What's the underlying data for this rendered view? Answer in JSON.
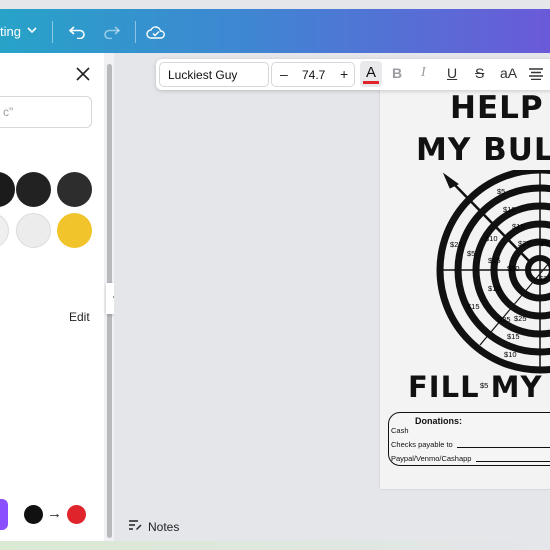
{
  "topbar": {
    "mode_label": "ting",
    "icons": [
      "chevron-down-icon",
      "undo-icon",
      "redo-icon",
      "cloud-save-icon"
    ]
  },
  "left_panel": {
    "search_placeholder": "c\"",
    "edit_label": "Edit",
    "swatch_colors": [
      "#1b1b1b",
      "#222222",
      "#2d2d2d",
      "#efefef",
      "#ececec",
      "#f1c42b"
    ],
    "gradient_from": "#111111",
    "gradient_to": "#e0242b",
    "arrow": "→"
  },
  "text_toolbar": {
    "font_name": "Luckiest Guy",
    "minus": "–",
    "font_size": "74.7",
    "plus": "+",
    "color_letter": "A",
    "bold": "B",
    "italic": "I",
    "underline": "U",
    "strike": "S",
    "case": "aA",
    "text_color": "#e0242b"
  },
  "poster": {
    "title_line1": "HELP F",
    "title_line2": "MY BULL",
    "bottom_title": "FILL MY T",
    "target_labels": [
      "$5",
      "$10",
      "$15",
      "$25",
      "$5",
      "$25",
      "$10",
      "$15",
      "$5",
      "$10",
      "$25",
      "$5",
      "$10",
      "$15",
      "$25",
      "$5",
      "$25",
      "$15",
      "$10"
    ],
    "donations_title": "Donations:",
    "cash_label": "Cash",
    "checks_label": "Checks payable to",
    "paypal_label": "Paypal/Venmo/Cashapp"
  },
  "footer": {
    "notes_label": "Notes"
  }
}
